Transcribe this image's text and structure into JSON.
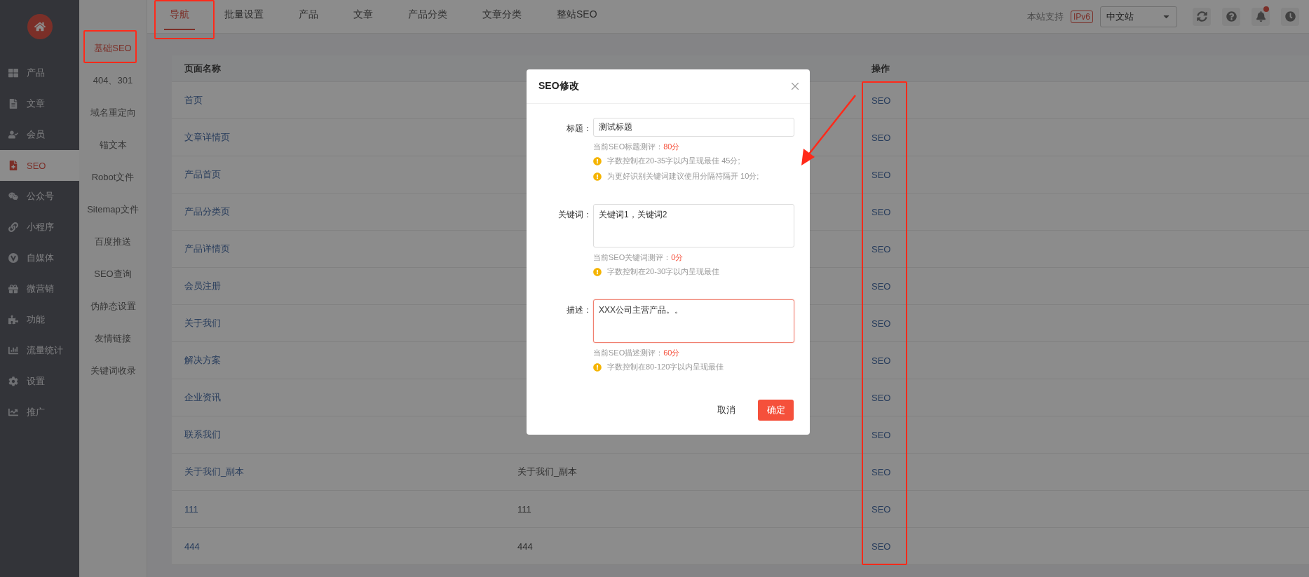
{
  "sidebar": {
    "items": [
      {
        "label": "产品",
        "selected": false
      },
      {
        "label": "文章",
        "selected": false
      },
      {
        "label": "会员",
        "selected": false
      },
      {
        "label": "SEO",
        "selected": true
      },
      {
        "label": "公众号",
        "selected": false
      },
      {
        "label": "小程序",
        "selected": false
      },
      {
        "label": "自媒体",
        "selected": false
      },
      {
        "label": "微营销",
        "selected": false
      },
      {
        "label": "功能",
        "selected": false
      },
      {
        "label": "流量统计",
        "selected": false
      },
      {
        "label": "设置",
        "selected": false
      },
      {
        "label": "推广",
        "selected": false
      }
    ]
  },
  "subnav": {
    "items": [
      {
        "label": "基础SEO",
        "selected": true
      },
      {
        "label": "404、301",
        "selected": false
      },
      {
        "label": "域名重定向",
        "selected": false
      },
      {
        "label": "锚文本",
        "selected": false
      },
      {
        "label": "Robot文件",
        "selected": false
      },
      {
        "label": "Sitemap文件",
        "selected": false
      },
      {
        "label": "百度推送",
        "selected": false
      },
      {
        "label": "SEO查询",
        "selected": false
      },
      {
        "label": "伪静态设置",
        "selected": false
      },
      {
        "label": "友情链接",
        "selected": false
      },
      {
        "label": "关键词收录",
        "selected": false
      }
    ]
  },
  "tabs": [
    {
      "label": "导航",
      "selected": true
    },
    {
      "label": "批量设置",
      "selected": false
    },
    {
      "label": "产品",
      "selected": false
    },
    {
      "label": "文章",
      "selected": false
    },
    {
      "label": "产品分类",
      "selected": false
    },
    {
      "label": "文章分类",
      "selected": false
    },
    {
      "label": "整站SEO",
      "selected": false
    }
  ],
  "header": {
    "support_label": "本站支持",
    "badge": "IPv6",
    "site_select": "中文站",
    "notification_dot": true
  },
  "table": {
    "columns": [
      {
        "label": "页面名称"
      },
      {},
      {
        "label": "操作"
      }
    ],
    "rows": [
      {
        "name": "首页",
        "action": "SEO"
      },
      {
        "name": "文章详情页",
        "action": "SEO"
      },
      {
        "name": "产品首页",
        "action": "SEO"
      },
      {
        "name": "产品分类页",
        "action": "SEO"
      },
      {
        "name": "产品详情页",
        "action": "SEO"
      },
      {
        "name": "会员注册",
        "action": "SEO"
      },
      {
        "name": "关于我们",
        "action": "SEO"
      },
      {
        "name": "解决方案",
        "action": "SEO"
      },
      {
        "name": "企业资讯",
        "action": "SEO"
      },
      {
        "name": "联系我们",
        "action": "SEO"
      },
      {
        "name": "关于我们_副本",
        "title": "关于我们_副本",
        "action": "SEO"
      },
      {
        "name": "111",
        "title": "111",
        "action": "SEO"
      },
      {
        "name": "444",
        "title": "444",
        "action": "SEO"
      }
    ]
  },
  "dialog": {
    "title": "SEO修改",
    "fields": [
      {
        "label": "标题：",
        "kind": "input",
        "value": "测试标题",
        "focused": false,
        "score_label": "当前SEO标题测评：",
        "score": "80分",
        "tips": [
          "字数控制在20-35字以内呈现最佳 45分;",
          "为更好识别关键词建议使用分隔符隔开 10分;"
        ]
      },
      {
        "label": "关键词：",
        "kind": "textarea",
        "value": "关键词1，关键词2",
        "focused": false,
        "score_label": "当前SEO关键词测评：",
        "score": "0分",
        "tips": [
          "字数控制在20-30字以内呈现最佳"
        ]
      },
      {
        "label": "描述：",
        "kind": "textarea",
        "value": "XXX公司主营产品。。",
        "focused": true,
        "score_label": "当前SEO描述测评：",
        "score": "60分",
        "tips": [
          "字数控制在80-120字以内呈现最佳"
        ]
      }
    ],
    "cancel": "取消",
    "confirm": "确定"
  }
}
